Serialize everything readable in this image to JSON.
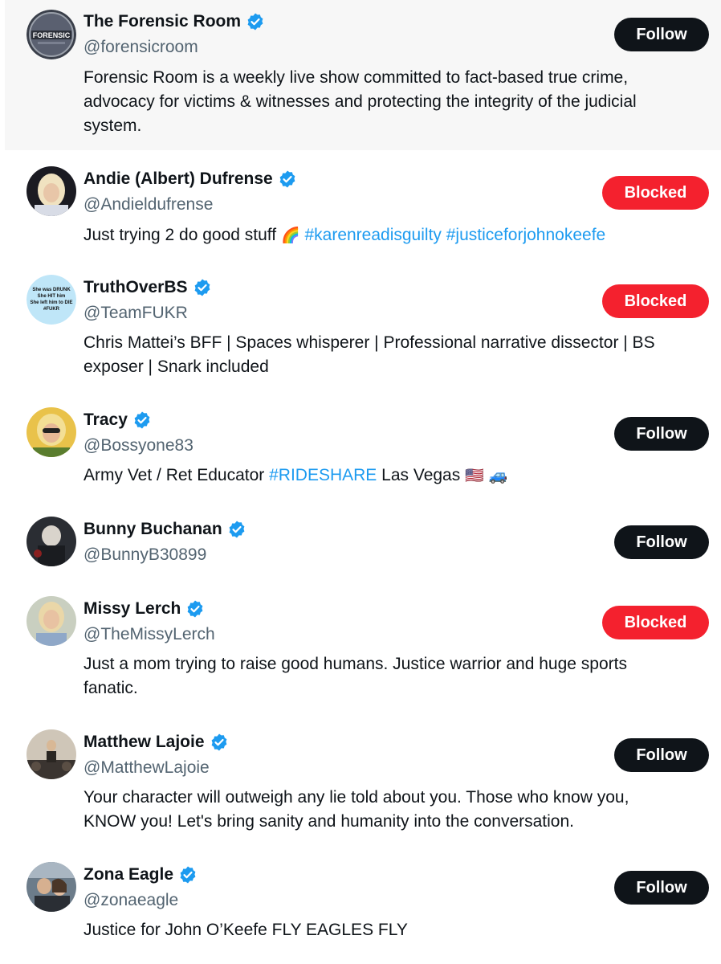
{
  "colors": {
    "follow_button": "#0f1419",
    "blocked_button": "#f4212e",
    "verified_badge": "#1d9bf0",
    "hashtag": "#1d9bf0",
    "handle": "#536471",
    "hover_row": "#f7f7f7"
  },
  "users": [
    {
      "name": "The Forensic Room",
      "handle": "@forensicroom",
      "verified": true,
      "button": "Follow",
      "avatar_text": "FORENSIC",
      "bio_lines": [
        "Forensic Room is a weekly live show committed to fact-based true crime,",
        "advocacy for victims & witnesses and protecting the integrity of the judicial",
        "system."
      ]
    },
    {
      "name": "Andie (Albert) Dufrense",
      "handle": "@Andieldufrense",
      "verified": true,
      "button": "Blocked",
      "bio_text": "Just trying 2 do good stuff",
      "bio_emoji": "🌈",
      "bio_hashtags": [
        "#karenreadisguilty",
        "#justiceforjohnokeefe"
      ]
    },
    {
      "name": "TruthOverBS",
      "handle": "@TeamFUKR",
      "verified": true,
      "button": "Blocked",
      "avatar_lines": [
        "She was DRUNK",
        "She HIT him",
        "She left him to DIE",
        "#FUKR"
      ],
      "bio_lines": [
        "Chris Mattei’s BFF | Spaces whisperer | Professional narrative dissector | BS",
        "exposer | Snark included"
      ]
    },
    {
      "name": "Tracy",
      "handle": "@Bossyone83",
      "verified": true,
      "button": "Follow",
      "bio_before": "Army Vet / Ret Educator",
      "bio_hashtag": "#RIDESHARE",
      "bio_after": "Las Vegas",
      "bio_emojis": [
        "🇺🇸",
        "🚙"
      ]
    },
    {
      "name": "Bunny Buchanan",
      "handle": "@BunnyB30899",
      "verified": true,
      "button": "Follow"
    },
    {
      "name": "Missy Lerch",
      "handle": "@TheMissyLerch",
      "verified": true,
      "button": "Blocked",
      "bio_lines": [
        "Just a mom trying to raise good humans. Justice warrior and huge sports",
        "fanatic."
      ]
    },
    {
      "name": "Matthew Lajoie",
      "handle": "@MatthewLajoie",
      "verified": true,
      "button": "Follow",
      "bio_lines": [
        "Your character will outweigh any lie told about you. Those who know you,",
        "KNOW you! Let's bring sanity and humanity into the conversation."
      ]
    },
    {
      "name": "Zona Eagle",
      "handle": "@zonaeagle",
      "verified": true,
      "button": "Follow",
      "bio_lines": [
        "Justice for John O’Keefe FLY EAGLES FLY"
      ]
    }
  ]
}
